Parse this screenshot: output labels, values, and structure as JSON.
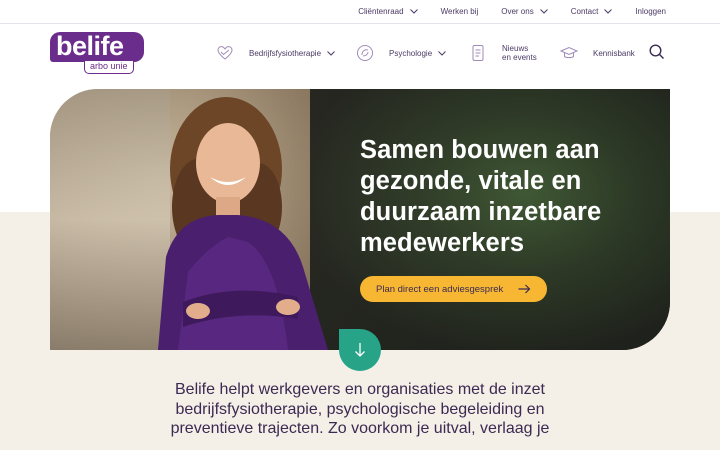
{
  "topnav": {
    "items": [
      {
        "label": "Cliëntenraad",
        "dropdown": true
      },
      {
        "label": "Werken bij",
        "dropdown": false
      },
      {
        "label": "Over ons",
        "dropdown": true
      },
      {
        "label": "Contact",
        "dropdown": true
      },
      {
        "label": "Inloggen",
        "dropdown": false
      }
    ]
  },
  "logo": {
    "word": "belife",
    "sub": "arbo unie"
  },
  "mainnav": {
    "items": [
      {
        "label": "Bedrijfsfysiotherapie",
        "icon": "physio-icon"
      },
      {
        "label": "Psychologie",
        "icon": "psychology-icon"
      },
      {
        "label_line1": "Nieuws",
        "label_line2": "en events",
        "icon": "news-icon"
      },
      {
        "label": "Kennisbank",
        "icon": "graduation-cap-icon"
      }
    ],
    "search_icon": "search-icon"
  },
  "hero": {
    "title": "Samen bouwen aan gezonde, vitale en duurzaam inzetbare medewerkers",
    "cta_label": "Plan direct een adviesgesprek",
    "scroll_icon": "arrow-down-icon"
  },
  "intro": {
    "text": "Belife helpt werkgevers en organisaties met de inzet bedrijfsfysiotherapie, psychologische begeleiding en preventieve trajecten. Zo voorkom je uitval, verlaag je"
  },
  "colors": {
    "brand_purple": "#6b2d8b",
    "text_dark": "#3b2a52",
    "accent_yellow": "#f7b733",
    "accent_green": "#27a387",
    "beige": "#f4efe7"
  }
}
